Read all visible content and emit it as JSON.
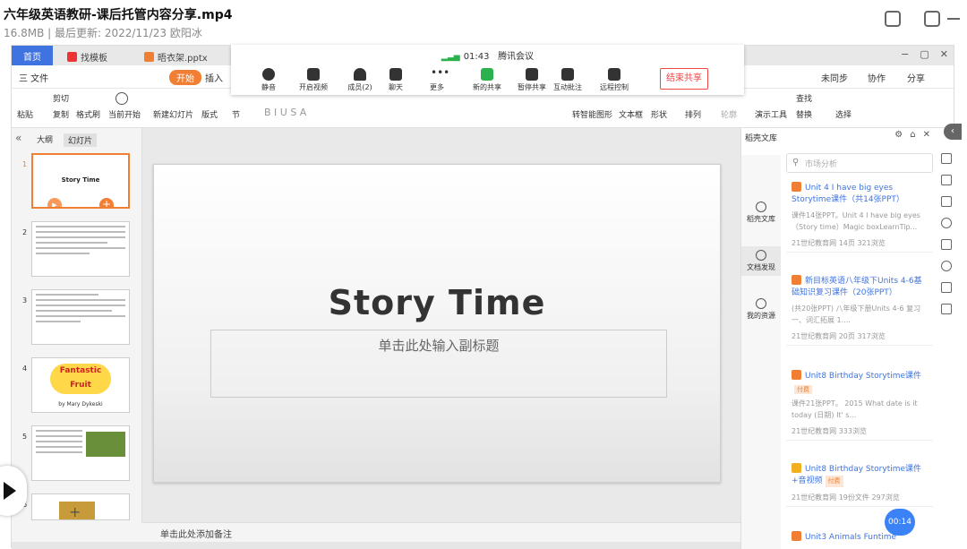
{
  "file": {
    "title": "六年级英语教研-课后托管内容分享.mp4",
    "meta": "16.8MB | 最后更新: 2022/11/23 欧阳冰"
  },
  "tabs": {
    "home": "首页",
    "template": "找模板",
    "pptx": "晤衣架.pptx"
  },
  "ribbon_tabs": {
    "file": "三 文件",
    "start": "开始",
    "insert": "插入"
  },
  "ribbon": {
    "paste": "粘贴",
    "cut": "剪切",
    "copy": "复制",
    "format_painter": "格式刷",
    "start_from_current": "当前开始",
    "new_slide": "新建幻灯片",
    "layout": "版式",
    "section": "节",
    "text_box": "文本框",
    "shape": "形状",
    "arrange": "排列",
    "outline": "轮廓",
    "presenter_tools": "演示工具",
    "find": "查找",
    "replace": "替换",
    "select": "选择",
    "sync": "未同步",
    "collab": "协作",
    "share": "分享",
    "smart_shape": "转智能图形"
  },
  "meeting": {
    "time": "01:43",
    "name": "腾讯会议",
    "mute": "静音",
    "video": "开启视频",
    "members": "成员(2)",
    "chat": "聊天",
    "more": "更多",
    "new_share": "新的共享",
    "pause_share": "暂停共享",
    "annotate": "互动批注",
    "remote": "远程控制",
    "end": "结束共享"
  },
  "left_panel": {
    "outline": "大纲",
    "slides": "幻灯片",
    "slide_title": "Story Time",
    "fantastic": "Fantastic Fruit",
    "by": "by Mary Dykeski"
  },
  "slide": {
    "title": "Story Time",
    "subtitle": "单击此处输入副标题"
  },
  "notes": "单击此处添加备注",
  "library": {
    "header": "稻壳文库",
    "search_placeholder": "市场分析",
    "nav_lib": "稻壳文库",
    "nav_discover": "文档发现",
    "nav_mine": "我的资源",
    "cards": [
      {
        "title": "Unit 4 I have big eyes Storytime课件（共14张PPT）",
        "desc": "课件14张PPT。Unit 4 I have big eyes（Story time）Magic boxLearnTip...",
        "meta": "21世纪教育网   14页   321浏览"
      },
      {
        "title": "新目标英语八年级下Units 4-6基础知识复习课件（20张PPT）",
        "desc": "(共20张PPT) 八年级下册Units 4-6 复习一、词汇拓展 1....",
        "meta": "21世纪教育网   20页   317浏览"
      },
      {
        "title": "Unit8 Birthday Storytime课件",
        "paid": "付费",
        "desc": "课件21张PPT。 2015 What date is it today (日期) It' s...",
        "meta": "21世纪教育网   333浏览"
      },
      {
        "title": "Unit8 Birthday Storytime课件+音视频",
        "paid": "付费",
        "meta": "21世纪教育网   19份文件   297浏览"
      },
      {
        "title": "Unit3 Animals Funtime"
      }
    ]
  },
  "time_badge": "00:14",
  "slide_numbers": [
    "1",
    "2",
    "3",
    "4",
    "5",
    "6"
  ]
}
